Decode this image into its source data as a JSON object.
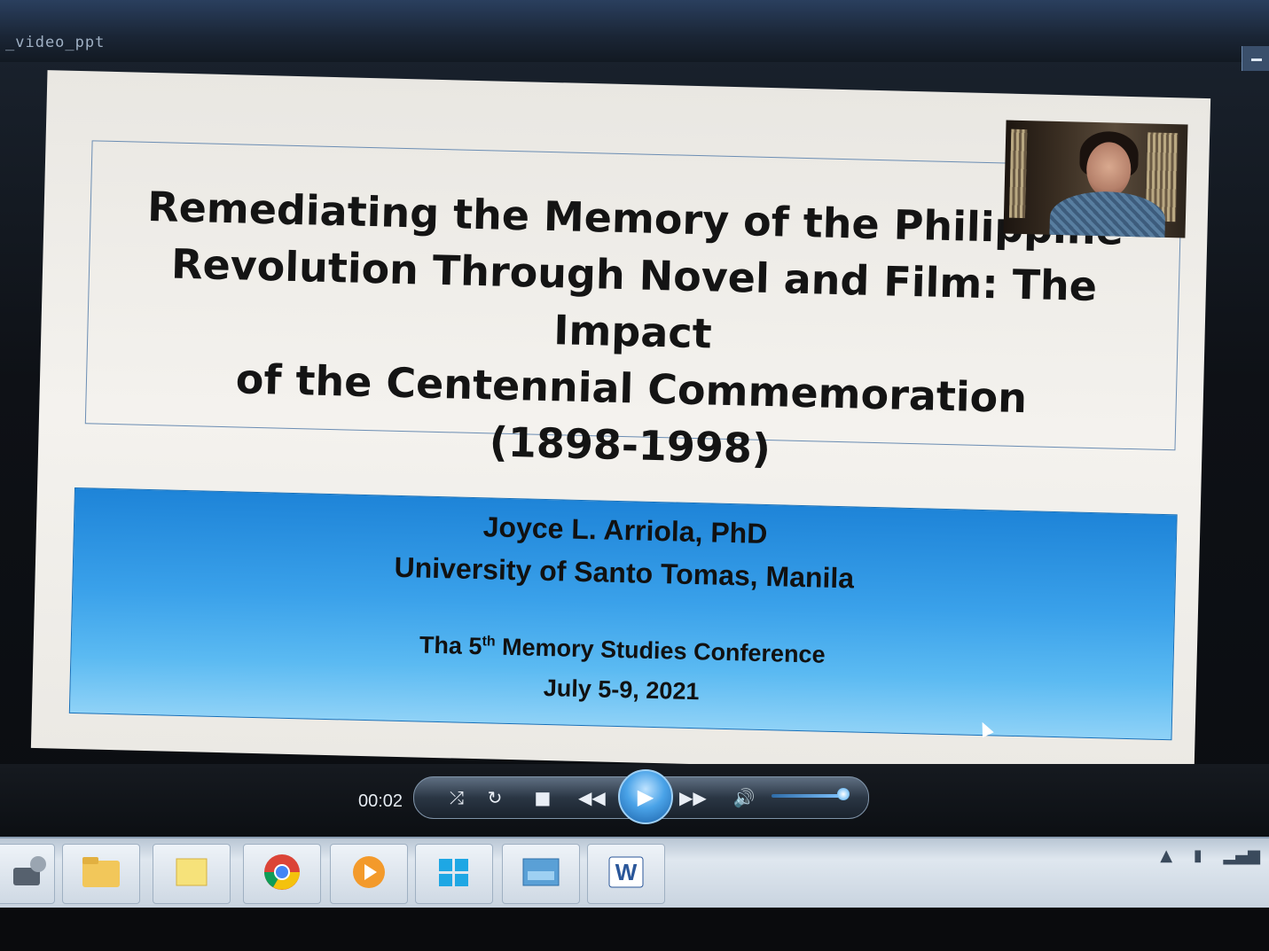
{
  "window": {
    "title": "_video_ppt"
  },
  "slide": {
    "title_lines": [
      "Remediating the Memory of the Philippine",
      "Revolution Through Novel and Film: The Impact",
      "of the Centennial Commemoration",
      "(1898-1998)"
    ],
    "author": "Joyce L. Arriola, PhD",
    "affiliation": "University of Santo Tomas, Manila",
    "conference_prefix": "Tha 5",
    "conference_sup": "th",
    "conference_suffix": " Memory Studies Conference",
    "dates": "July 5-9, 2021"
  },
  "player": {
    "elapsed": "00:02",
    "icons": {
      "shuffle": "shuffle-icon",
      "repeat": "repeat-icon",
      "stop": "stop-icon",
      "previous": "previous-icon",
      "play": "play-icon",
      "next": "next-icon",
      "volume": "volume-icon"
    },
    "volume_level": 0.9
  },
  "taskbar": {
    "apps": [
      "settings",
      "file-explorer",
      "sticky-notes",
      "chrome",
      "media-player",
      "windows-store",
      "photo-viewer",
      "word"
    ]
  },
  "colors": {
    "info_box": "#3aa1ea",
    "title_border": "#6b8db3",
    "play_button": "#4aa3e8"
  }
}
